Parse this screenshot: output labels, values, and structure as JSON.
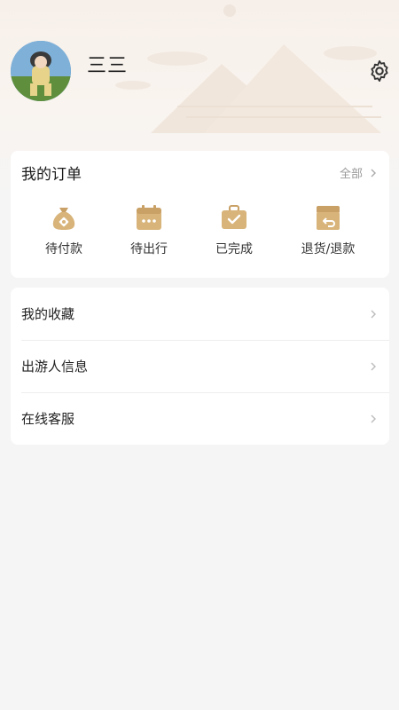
{
  "profile": {
    "username": "三三"
  },
  "orders": {
    "title": "我的订单",
    "all_label": "全部",
    "items": [
      {
        "label": "待付款",
        "icon": "money-bag-icon"
      },
      {
        "label": "待出行",
        "icon": "calendar-icon"
      },
      {
        "label": "已完成",
        "icon": "briefcase-check-icon"
      },
      {
        "label": "退货/退款",
        "icon": "return-box-icon"
      }
    ]
  },
  "menu": {
    "items": [
      {
        "label": "我的收藏"
      },
      {
        "label": "出游人信息"
      },
      {
        "label": "在线客服"
      }
    ]
  },
  "colors": {
    "accent_gold": "#c9a065",
    "background": "#f5f5f5",
    "card": "#ffffff"
  }
}
